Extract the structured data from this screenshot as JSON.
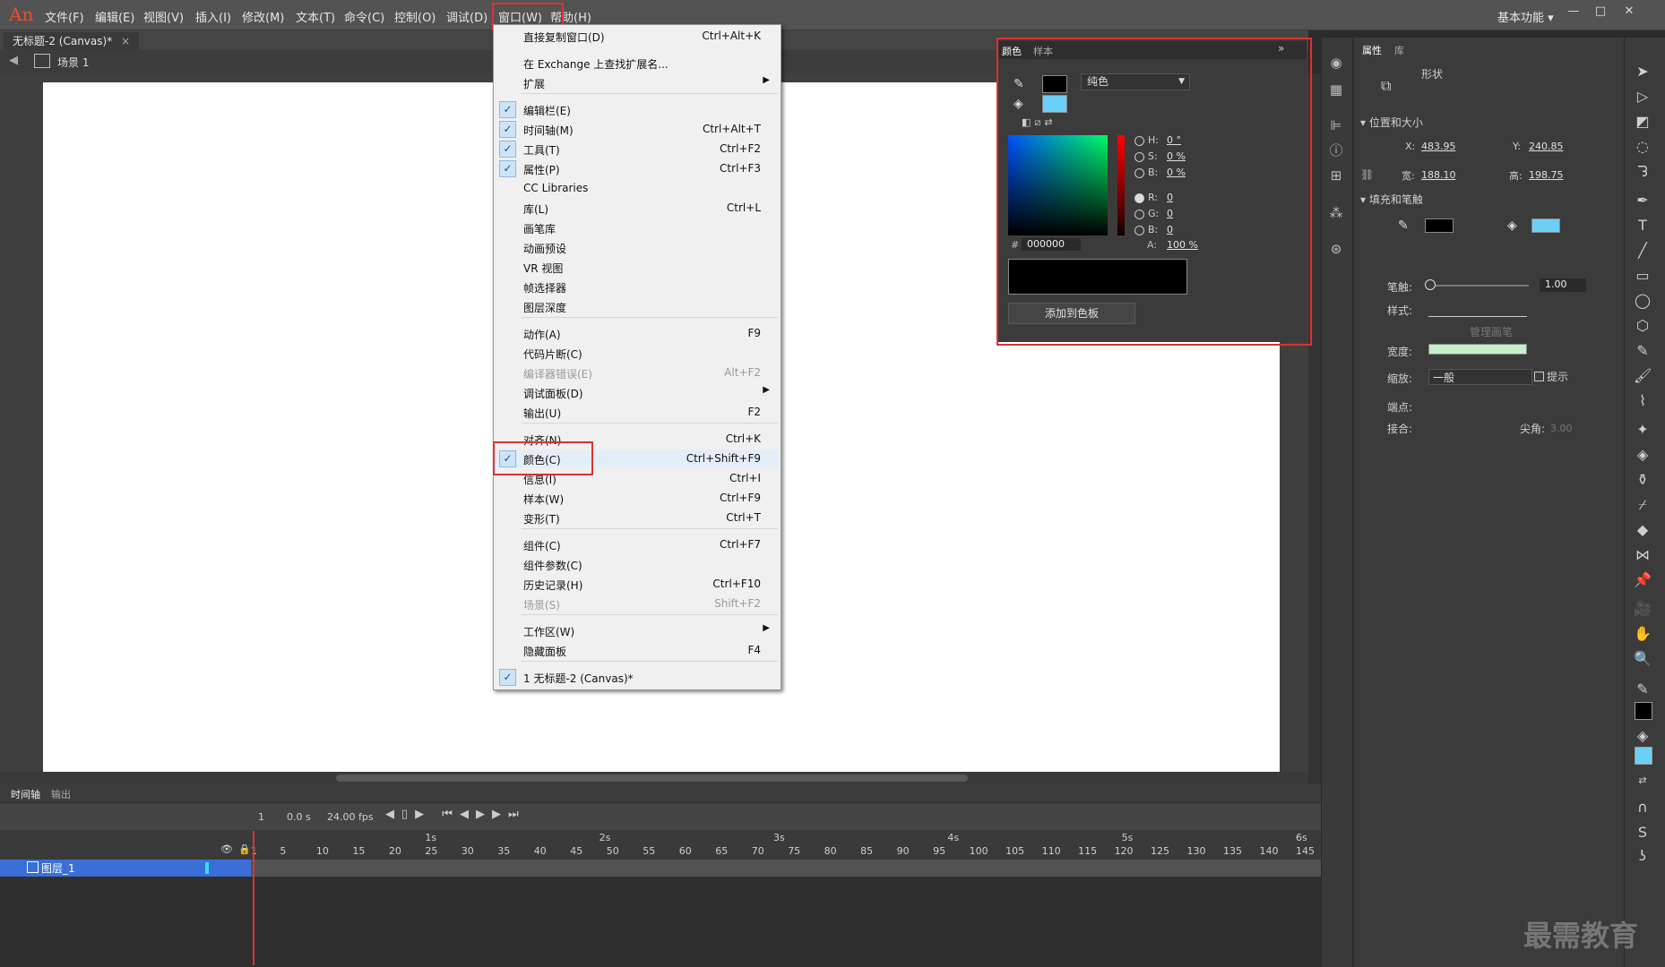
{
  "app": {
    "logo": "An",
    "workspace": "基本功能 ▾",
    "watermark": "最需教育"
  },
  "menubar": [
    "文件(F)",
    "编辑(E)",
    "视图(V)",
    "插入(I)",
    "修改(M)",
    "文本(T)",
    "命令(C)",
    "控制(O)",
    "调试(D)",
    "窗口(W)",
    "帮助(H)"
  ],
  "window_buttons": [
    "—",
    "□",
    "✕"
  ],
  "document": {
    "tab": "无标题-2 (Canvas)*",
    "tab_close": "×",
    "scene": "场景 1"
  },
  "window_menu": {
    "items": [
      {
        "label": "直接复制窗口(D)",
        "shortcut": "Ctrl+Alt+K",
        "checked": false
      },
      {
        "label": "在 Exchange 上查找扩展名...",
        "shortcut": ""
      },
      {
        "label": "扩展",
        "shortcut": "",
        "submenu": true
      },
      {
        "label": "编辑栏(E)",
        "shortcut": "",
        "checked": true
      },
      {
        "label": "时间轴(M)",
        "shortcut": "Ctrl+Alt+T",
        "checked": true
      },
      {
        "label": "工具(T)",
        "shortcut": "Ctrl+F2",
        "checked": true
      },
      {
        "label": "属性(P)",
        "shortcut": "Ctrl+F3",
        "checked": true
      },
      {
        "label": "CC Libraries",
        "shortcut": ""
      },
      {
        "label": "库(L)",
        "shortcut": "Ctrl+L"
      },
      {
        "label": "画笔库",
        "shortcut": ""
      },
      {
        "label": "动画预设",
        "shortcut": ""
      },
      {
        "label": "VR 视图",
        "shortcut": ""
      },
      {
        "label": "帧选择器",
        "shortcut": ""
      },
      {
        "label": "图层深度",
        "shortcut": ""
      },
      {
        "label": "动作(A)",
        "shortcut": "F9"
      },
      {
        "label": "代码片断(C)",
        "shortcut": ""
      },
      {
        "label": "编译器错误(E)",
        "shortcut": "Alt+F2",
        "disabled": true
      },
      {
        "label": "调试面板(D)",
        "shortcut": "",
        "submenu": true
      },
      {
        "label": "输出(U)",
        "shortcut": "F2"
      },
      {
        "label": "对齐(N)",
        "shortcut": "Ctrl+K"
      },
      {
        "label": "颜色(C)",
        "shortcut": "Ctrl+Shift+F9",
        "checked": true
      },
      {
        "label": "信息(I)",
        "shortcut": "Ctrl+I"
      },
      {
        "label": "样本(W)",
        "shortcut": "Ctrl+F9"
      },
      {
        "label": "变形(T)",
        "shortcut": "Ctrl+T"
      },
      {
        "label": "组件(C)",
        "shortcut": "Ctrl+F7"
      },
      {
        "label": "组件参数(C)",
        "shortcut": ""
      },
      {
        "label": "历史记录(H)",
        "shortcut": "Ctrl+F10"
      },
      {
        "label": "场景(S)",
        "shortcut": "Shift+F2",
        "disabled": true
      },
      {
        "label": "工作区(W)",
        "shortcut": "",
        "submenu": true
      },
      {
        "label": "隐藏面板",
        "shortcut": "F4"
      },
      {
        "label": "1 无标题-2 (Canvas)*",
        "shortcut": "",
        "checked": true
      }
    ]
  },
  "color_panel": {
    "tabs": [
      "颜色",
      "样本"
    ],
    "fill_type": "纯色",
    "stroke_color": "#000000",
    "fill_color": "#6ccff6",
    "hsb": {
      "H_label": "H:",
      "H": "0 °",
      "S_label": "S:",
      "S": "0 %",
      "B_label": "B:",
      "B": "0 %"
    },
    "rgb": {
      "R_label": "R:",
      "R": "0",
      "G_label": "G:",
      "G": "0",
      "B_label": "B:",
      "B": "0"
    },
    "hex_label": "#",
    "hex": "000000",
    "alpha_label": "A:",
    "alpha": "100 %",
    "add_button": "添加到色板"
  },
  "properties": {
    "tabs": [
      "属性",
      "库"
    ],
    "type": "形状",
    "section_position": "位置和大小",
    "x_label": "X:",
    "x": "483.95",
    "y_label": "Y:",
    "y": "240.85",
    "w_label": "宽:",
    "w": "188.10",
    "h_label": "高:",
    "h": "198.75",
    "section_fill": "填充和笔触",
    "stroke_label": "笔触:",
    "stroke_value": "1.00",
    "style_label": "样式:",
    "manage_label": "管理画笔",
    "width_label": "宽度:",
    "scale_label": "缩放:",
    "scale_value": "一般",
    "hint_label": "提示",
    "cap_label": "端点:",
    "join_label": "接合:",
    "miter_label": "尖角:",
    "miter_value": "3.00"
  },
  "timeline": {
    "tabs": [
      "时间轴",
      "输出"
    ],
    "frame": "1",
    "time": "0.0 s",
    "fps": "24.00 fps",
    "layer": "图层_1",
    "seconds": [
      "1s",
      "2s",
      "3s",
      "4s",
      "5s",
      "6s"
    ],
    "frames": [
      "1",
      "5",
      "10",
      "15",
      "20",
      "25",
      "30",
      "35",
      "40",
      "45",
      "50",
      "55",
      "60",
      "65",
      "70",
      "75",
      "80",
      "85",
      "90",
      "95",
      "100",
      "105",
      "110",
      "115",
      "120",
      "125",
      "130",
      "135",
      "140",
      "145"
    ]
  }
}
